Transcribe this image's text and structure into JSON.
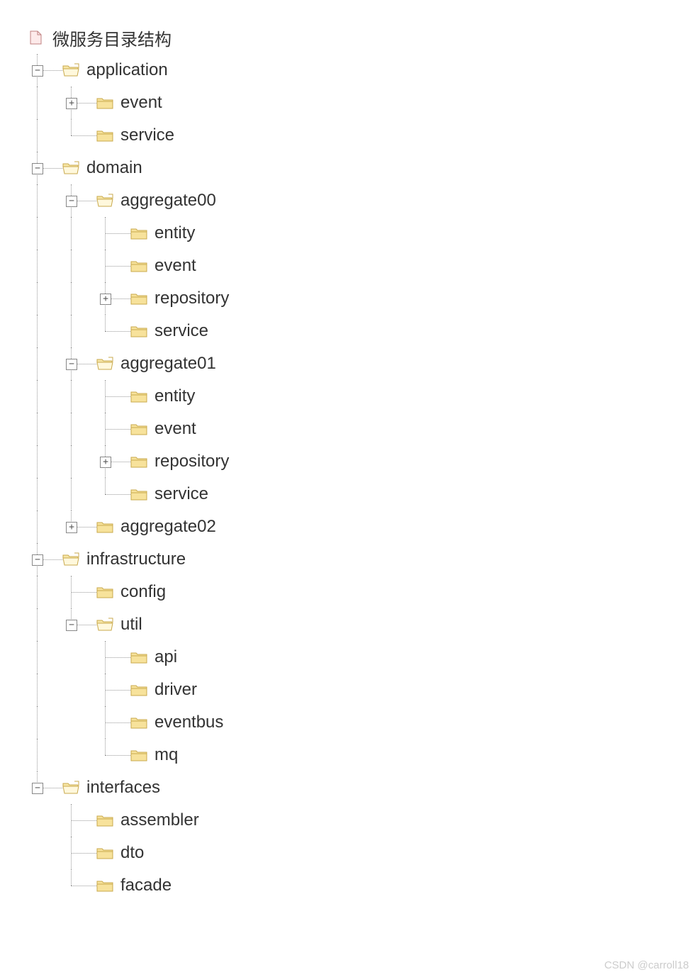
{
  "tree": {
    "root": {
      "label": "微服务目录结构",
      "icon": "file"
    },
    "application": {
      "label": "application",
      "icon": "folder",
      "toggle": "−"
    },
    "application_event": {
      "label": "event",
      "icon": "folder-closed",
      "toggle": "+"
    },
    "application_service": {
      "label": "service",
      "icon": "folder-closed"
    },
    "domain": {
      "label": "domain",
      "icon": "folder",
      "toggle": "−"
    },
    "aggregate00": {
      "label": "aggregate00",
      "icon": "folder",
      "toggle": "−"
    },
    "aggregate00_entity": {
      "label": "entity",
      "icon": "folder-closed"
    },
    "aggregate00_event": {
      "label": "event",
      "icon": "folder-closed"
    },
    "aggregate00_repository": {
      "label": "repository",
      "icon": "folder-closed",
      "toggle": "+"
    },
    "aggregate00_service": {
      "label": "service",
      "icon": "folder-closed"
    },
    "aggregate01": {
      "label": "aggregate01",
      "icon": "folder",
      "toggle": "−"
    },
    "aggregate01_entity": {
      "label": "entity",
      "icon": "folder-closed"
    },
    "aggregate01_event": {
      "label": "event",
      "icon": "folder-closed"
    },
    "aggregate01_repository": {
      "label": "repository",
      "icon": "folder-closed",
      "toggle": "+"
    },
    "aggregate01_service": {
      "label": "service",
      "icon": "folder-closed"
    },
    "aggregate02": {
      "label": "aggregate02",
      "icon": "folder-closed",
      "toggle": "+"
    },
    "infrastructure": {
      "label": "infrastructure",
      "icon": "folder",
      "toggle": "−"
    },
    "infrastructure_config": {
      "label": "config",
      "icon": "folder-closed"
    },
    "infrastructure_util": {
      "label": "util",
      "icon": "folder",
      "toggle": "−"
    },
    "util_api": {
      "label": "api",
      "icon": "folder-closed"
    },
    "util_driver": {
      "label": "driver",
      "icon": "folder-closed"
    },
    "util_eventbus": {
      "label": "eventbus",
      "icon": "folder-closed"
    },
    "util_mq": {
      "label": "mq",
      "icon": "folder-closed"
    },
    "interfaces": {
      "label": "interfaces",
      "icon": "folder",
      "toggle": "−"
    },
    "interfaces_assembler": {
      "label": "assembler",
      "icon": "folder-closed"
    },
    "interfaces_dto": {
      "label": "dto",
      "icon": "folder-closed"
    },
    "interfaces_facade": {
      "label": "facade",
      "icon": "folder-closed"
    }
  },
  "watermark": "CSDN @carroll18"
}
